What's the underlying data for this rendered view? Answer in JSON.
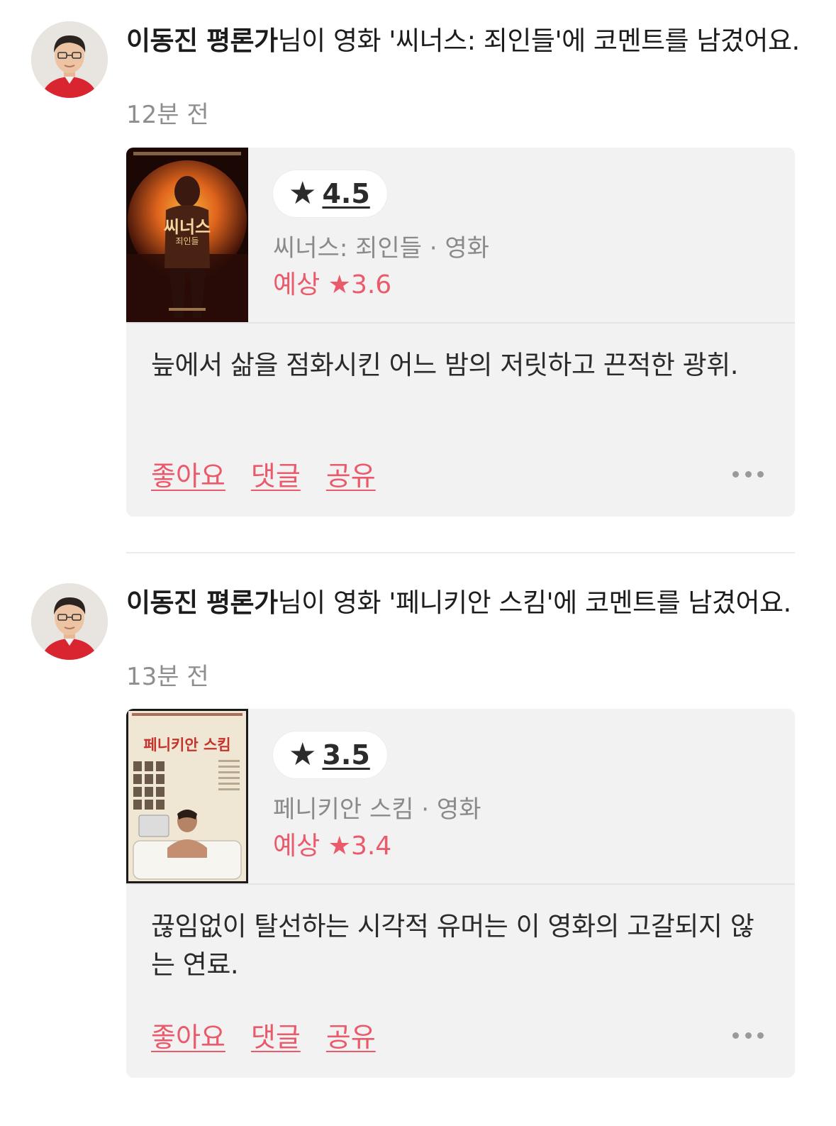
{
  "feed": [
    {
      "author": "이동진 평론가",
      "action_text": "님이 영화 '씨너스: 죄인들'에 코멘트를 남겼어요.",
      "time": "12분 전",
      "rating": "4.5",
      "movie_meta": "씨너스: 죄인들 · 영화",
      "expected": "예상 ★3.6",
      "comment": "늪에서 삶을 점화시킨 어느 밤의 저릿하고 끈적한 광휘.",
      "actions": {
        "like": "좋아요",
        "comment": "댓글",
        "share": "공유"
      },
      "poster_title": "씨너스",
      "poster_subtitle": "죄인들"
    },
    {
      "author": "이동진 평론가",
      "action_text": "님이 영화 '페니키안 스킴'에 코멘트를 남겼어요.",
      "time": "13분 전",
      "rating": "3.5",
      "movie_meta": "페니키안 스킴 · 영화",
      "expected": "예상 ★3.4",
      "comment": "끊임없이 탈선하는 시각적 유머는 이 영화의 고갈되지 않는 연료.",
      "actions": {
        "like": "좋아요",
        "comment": "댓글",
        "share": "공유"
      },
      "poster_title": "페니키안 스킴"
    }
  ],
  "icons": {
    "rating_star": "★",
    "more": "more-horizontal-icon"
  },
  "colors": {
    "accent": "#ea5a6b",
    "card_bg": "#f2f2f2",
    "muted": "#8e8e8e"
  }
}
